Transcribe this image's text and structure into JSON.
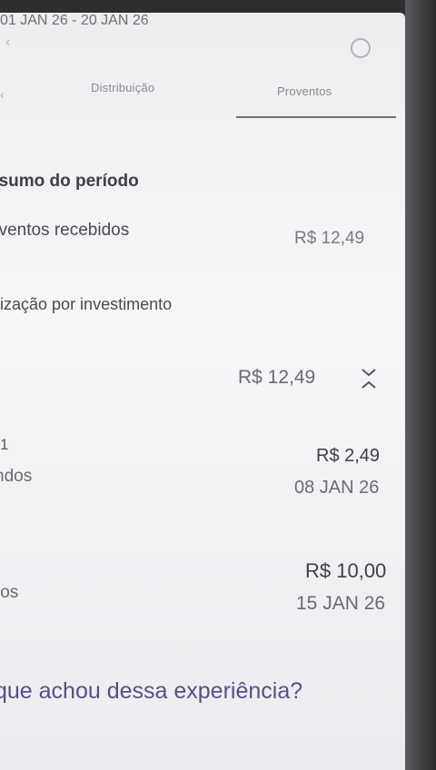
{
  "tabs": [
    {
      "label": "Distribuição",
      "active": false
    },
    {
      "label": "Proventos",
      "active": true
    }
  ],
  "summary": {
    "title": "esumo do período",
    "period": "01 JAN 26 - 20 JAN 26",
    "received_label": "oventos recebidos",
    "received_value": "R$ 12,49"
  },
  "breakdown": {
    "title": "alização por investimento",
    "total_value": "R$ 12,49",
    "items": [
      {
        "id": "1",
        "type": "ndos",
        "value": "R$ 2,49",
        "date": "08 JAN 26"
      },
      {
        "type": "los",
        "value": "R$ 10,00",
        "date": "15 JAN 26"
      }
    ]
  },
  "feedback": {
    "question": "que achou dessa experiência?"
  },
  "colors": {
    "accent_purple": "#5b4d86",
    "tab_underline": "#707078"
  },
  "icons": {
    "help": "help-circle-icon",
    "collapse": "chevron-collapse-icon"
  }
}
